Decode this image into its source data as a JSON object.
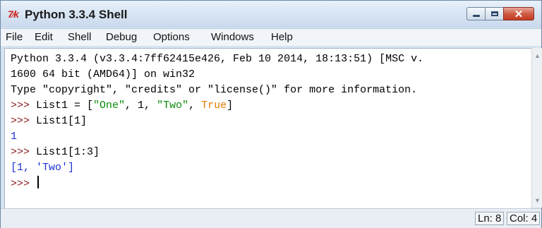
{
  "window": {
    "title": "Python 3.3.4 Shell",
    "icon": "tk-feather-icon",
    "icon_text": "7⁄k"
  },
  "menu": [
    "File",
    "Edit",
    "Shell",
    "Debug",
    "Options",
    "Windows",
    "Help"
  ],
  "shell": {
    "banner_1": "Python 3.3.4 (v3.3.4:7ff62415e426, Feb 10 2014, 18:13:51) [MSC v.",
    "banner_2": "1600 64 bit (AMD64)] on win32",
    "banner_3": "Type \"copyright\", \"credits\" or \"license()\" for more information.",
    "prompt": ">>> ",
    "cmd1_name": "List1 = [",
    "cmd1_str1": "\"One\"",
    "cmd1_mid": ", 1, ",
    "cmd1_str2": "\"Two\"",
    "cmd1_sep": ", ",
    "cmd1_kw": "True",
    "cmd1_end": "]",
    "cmd2": "List1[1]",
    "out2": "1",
    "cmd3": "List1[1:3]",
    "out3": "[1, 'Two']"
  },
  "status": {
    "line": "Ln: 8",
    "col": "Col: 4"
  },
  "colors": {
    "prompt": "#8b1a1a",
    "output": "#1d31d8",
    "string": "#0a8a0a",
    "keyword": "#e87a00"
  }
}
